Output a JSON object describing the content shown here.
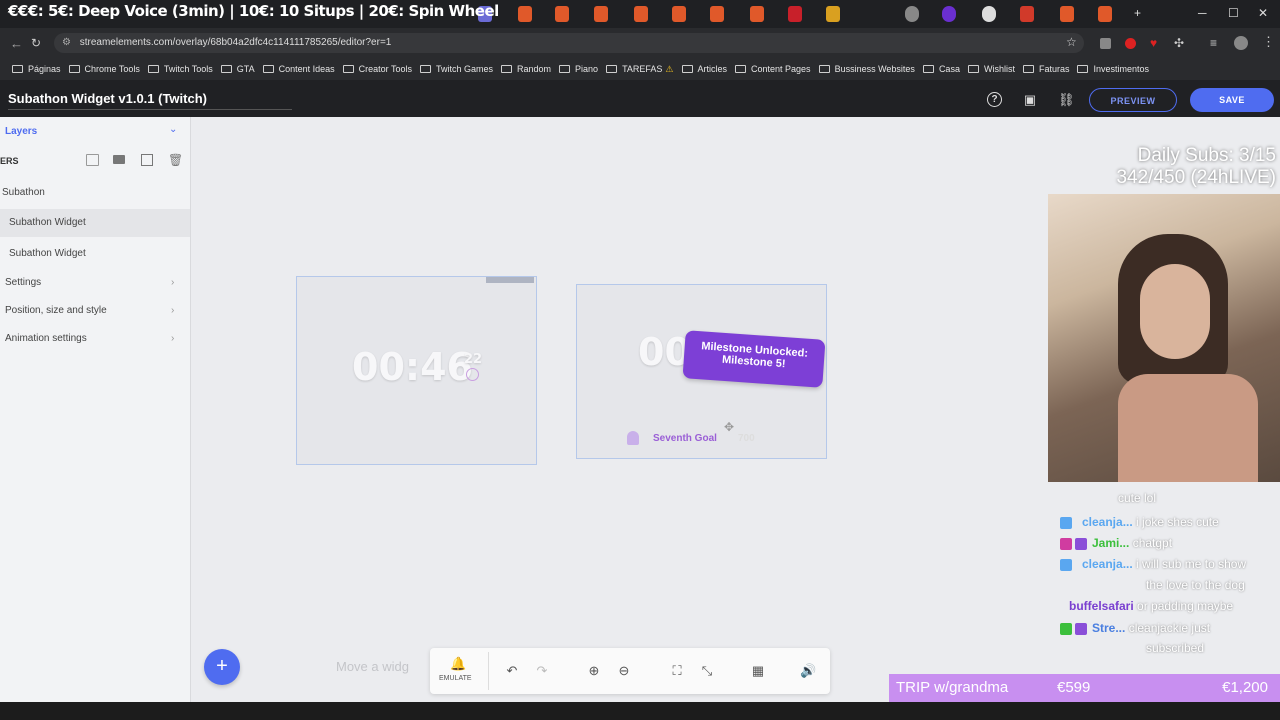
{
  "banner": {
    "text": "€€€: 5€: Deep Voice (3min) | 10€: 10 Situps | 20€: Spin Wheel"
  },
  "tabs": {
    "new_tab": "+",
    "minimize": "─",
    "maximize": "☐",
    "close": "✕"
  },
  "address": {
    "url": "streamelements.com/overlay/68b04a2dfc4c114111785265/editor?er=1"
  },
  "bookmarks": [
    "Páginas",
    "Chrome Tools",
    "Twitch Tools",
    "GTA",
    "Content Ideas",
    "Creator Tools",
    "Twitch Games",
    "Random",
    "Piano",
    "TAREFAS",
    "Articles",
    "Content Pages",
    "Bussiness Websites",
    "Casa",
    "Wishlist",
    "Faturas",
    "Investimentos"
  ],
  "app": {
    "title": "Subathon Widget v1.0.1 (Twitch)",
    "preview_label": "PREVIEW",
    "save_label": "SAVE"
  },
  "sidebar": {
    "layers_label": "Layers",
    "layers_header": "ERS",
    "group_label": "Subathon",
    "items": [
      "Subathon Widget",
      "Subathon Widget"
    ],
    "sections": [
      "Settings",
      "Position, size and style",
      "Animation settings"
    ]
  },
  "canvas": {
    "timer1": "00:46",
    "timer1_sub": "22",
    "timer2": "00",
    "milestone_line1": "Milestone Unlocked:",
    "milestone_line2": "Milestone 5!",
    "goal_label": "Seventh Goal",
    "goal_value": "700",
    "move_hint": "Move a widg",
    "emulate_label": "EMULATE"
  },
  "stream": {
    "daily_subs": "Daily Subs: 3/15",
    "sub_goal": "342/450 (24hLIVE)",
    "goal_name": "TRIP w/grandma",
    "goal_current": "€599",
    "goal_target": "€1,200",
    "chat": [
      {
        "name": "",
        "msg": "cute lol"
      },
      {
        "name": "cleanja...",
        "msg": "i joke shes cute"
      },
      {
        "name": "Jami...",
        "msg": "chatgpt"
      },
      {
        "name": "cleanja...",
        "msg": "i will sub me to show"
      },
      {
        "name": "",
        "msg": "the love to the dog"
      },
      {
        "name": "buffelsafari",
        "msg": "or padding maybe"
      },
      {
        "name": "Stre...",
        "msg": "cleanjackie just"
      },
      {
        "name": "",
        "msg": "subscribed"
      }
    ]
  },
  "colors": {
    "accent": "#4f6cf0",
    "milestone": "#7d3fd6",
    "goal_bar": "#c88ff0"
  }
}
